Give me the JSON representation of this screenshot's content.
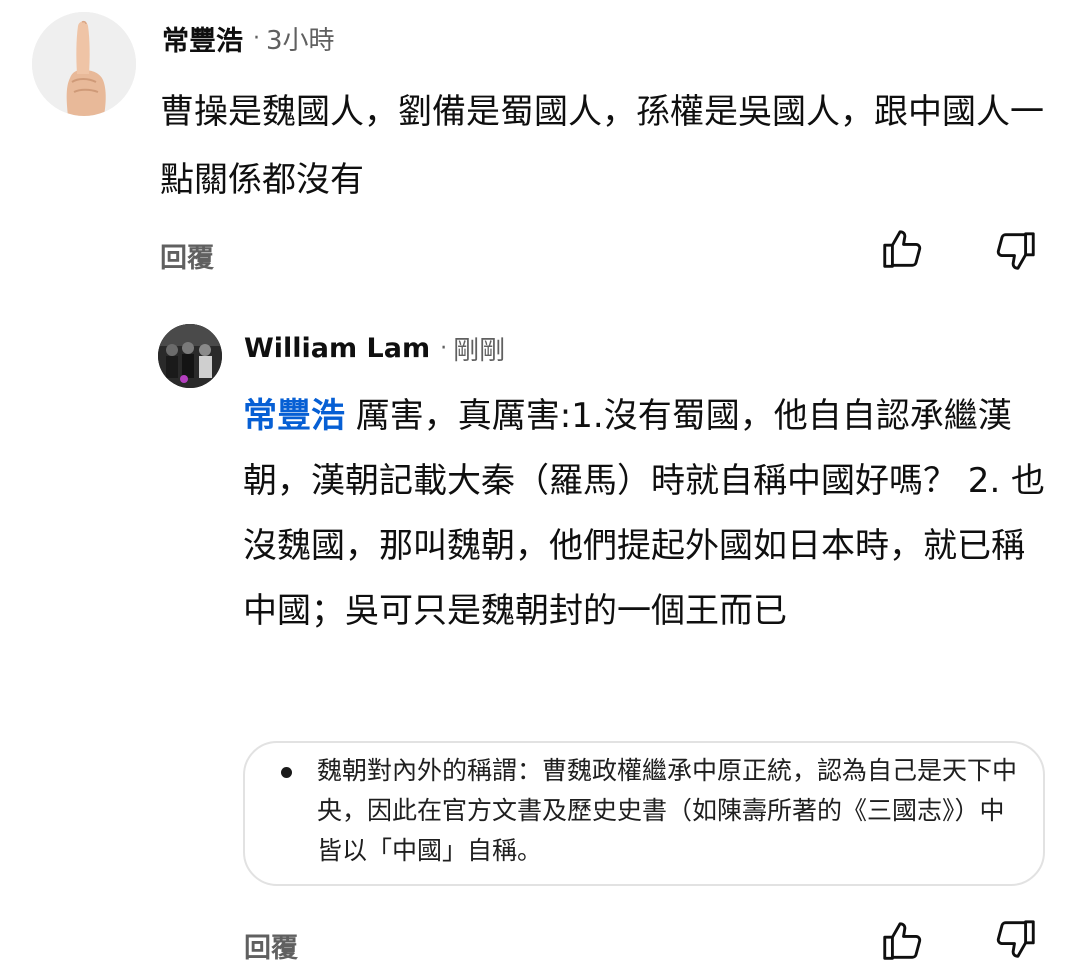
{
  "comment": {
    "author": "常豐浩",
    "separator": "·",
    "time": "3小時",
    "text": "曹操是魏國人，劉備是蜀國人，孫權是吳國人，跟中國人一點關係都沒有",
    "reply_label": "回覆",
    "like_icon": "thumb-up-icon",
    "dislike_icon": "thumb-down-icon"
  },
  "reply": {
    "author": "William Lam",
    "separator": "·",
    "time": "剛剛",
    "mention": "常豐浩",
    "text": " 厲害，真厲害:1.沒有蜀國，他自自認承繼漢朝，漢朝記載大秦（羅馬）時就自稱中國好嗎？ 2. 也沒魏國，那叫魏朝，他們提起外國如日本時，就已稱中國；吳可只是魏朝封的一個王而已",
    "quote": "魏朝對內外的稱謂：曹魏政權繼承中原正統，認為自己是天下中央，因此在官方文書及歷史史書（如陳壽所著的《三國志》）中皆以「中國」自稱。",
    "reply_label": "回覆",
    "like_icon": "thumb-up-icon",
    "dislike_icon": "thumb-down-icon"
  },
  "colors": {
    "mention": "#065fd4",
    "secondary_text": "#606060",
    "primary_text": "#0f0f0f"
  }
}
